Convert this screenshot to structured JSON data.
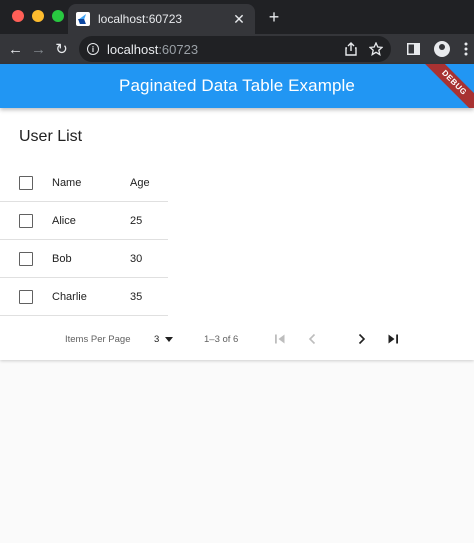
{
  "browser": {
    "tab_title": "localhost:60723",
    "url_host": "localhost",
    "url_port": ":60723"
  },
  "app": {
    "title": "Paginated Data Table Example",
    "debug_banner": "DEBUG"
  },
  "card": {
    "title": "User List",
    "columns": [
      "Name",
      "Age"
    ],
    "rows": [
      {
        "name": "Alice",
        "age": "25"
      },
      {
        "name": "Bob",
        "age": "30"
      },
      {
        "name": "Charlie",
        "age": "35"
      }
    ]
  },
  "pagination": {
    "items_per_page_label": "Items Per Page",
    "items_per_page_value": "3",
    "range_text": "1–3 of 6"
  },
  "colors": {
    "appbar": "#2196f3",
    "debug_banner": "#a83232"
  }
}
